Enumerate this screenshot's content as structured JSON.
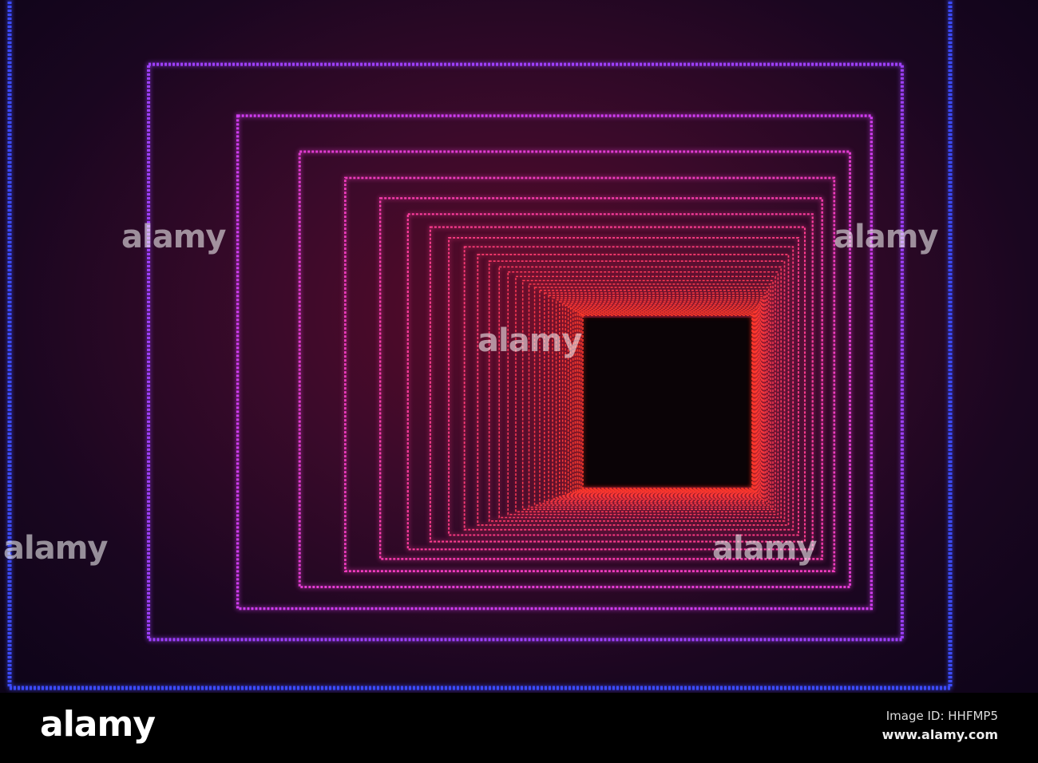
{
  "photo": {
    "description_colors": {
      "outer": "#3b4bff",
      "mid": "#c43cff",
      "pink": "#ff3caa",
      "inner": "#ff3a2a"
    },
    "watermark_text": "alamy"
  },
  "footer": {
    "logo": "alamy",
    "image_id": "Image ID: HHFMP5",
    "url": "www.alamy.com"
  }
}
